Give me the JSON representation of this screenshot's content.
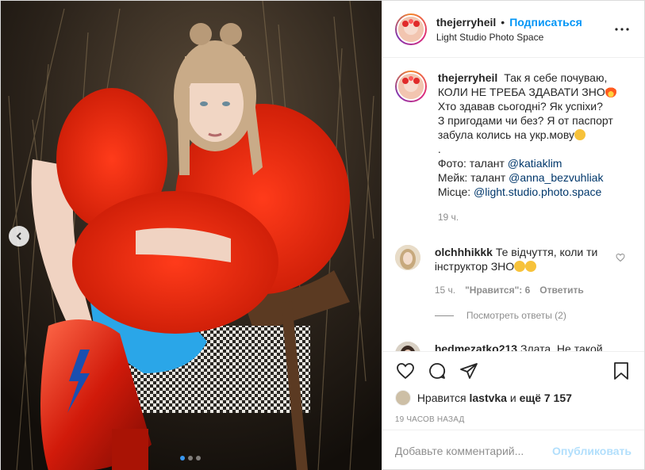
{
  "header": {
    "username": "thejerryheil",
    "separator": "•",
    "follow_label": "Подписаться",
    "location": "Light Studio Photo Space",
    "more_icon": "more-horizontal-icon"
  },
  "caption": {
    "username": "thejerryheil",
    "lines": [
      "Так я себе почуваю,",
      "КОЛИ НЕ ТРЕБА ЗДАВАТИ ЗНО",
      "Хто здавав сьогодні? Як успіхи?",
      "З пригодами чи без? Я от паспорт",
      "забула колись на укр.мову",
      "."
    ],
    "credits": [
      {
        "label": "Фото: талант ",
        "mention": "@katiaklim"
      },
      {
        "label": "Мейк: талант ",
        "mention": "@anna_bezvuhliak"
      },
      {
        "label": "Місце: ",
        "mention": "@light.studio.photo.space"
      }
    ],
    "time": "19 ч."
  },
  "comment": {
    "username": "olchhhikkk",
    "text": "Те відчуття, коли ти інструктор ЗНО",
    "time": "15 ч.",
    "likes": "\"Нравится\": 6",
    "reply_label": "Ответить",
    "view_replies": "Посмотреть ответы (2)"
  },
  "comment_cut": {
    "username": "hedmezatko213",
    "text": "Злата. Не такой"
  },
  "likes": {
    "prefix": "Нравится",
    "user": "lastvka",
    "middle": "и",
    "others": "ещё 7 157"
  },
  "post_time": "19 ЧАСОВ НАЗАД",
  "add_comment": {
    "placeholder": "Добавьте комментарий...",
    "publish_label": "Опубликовать"
  },
  "carousel": {
    "slides": 3,
    "active": 0
  },
  "colors": {
    "accent": "#0095f6",
    "publish_disabled": "#b2dffc",
    "muted": "#8e8e8e",
    "mention": "#00376b"
  }
}
